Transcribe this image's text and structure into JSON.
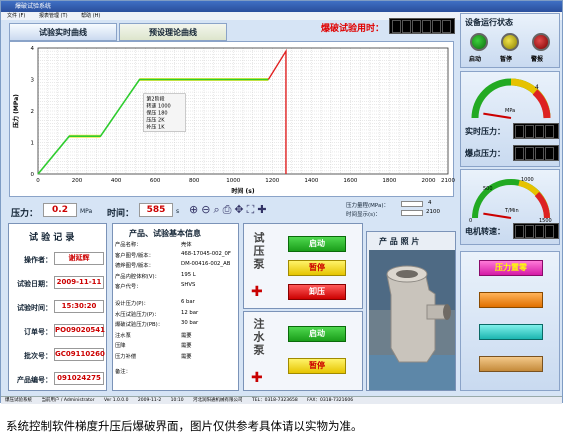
{
  "window": {
    "title": "爆破试验系统",
    "menu": [
      "文件 (F)",
      "报表管理 (T)",
      "帮助 (H)"
    ]
  },
  "tabs": {
    "realtime": "试验实时曲线",
    "preset": "预设理论曲线"
  },
  "timer": {
    "label": "爆破试验用时："
  },
  "chart_data": {
    "type": "line",
    "xlabel": "时间 (s)",
    "ylabel": "压力 (MPa)",
    "xlim": [
      0,
      2100
    ],
    "ylim": [
      0,
      4
    ],
    "x_ticks": [
      0,
      200,
      400,
      600,
      800,
      1000,
      1200,
      1400,
      1600,
      1800,
      2000,
      2100
    ],
    "y_ticks": [
      0,
      1,
      2,
      3,
      4
    ],
    "series": [
      {
        "x": [
          0,
          160,
          320,
          520,
          1180,
          1270,
          1270
        ],
        "y": [
          0,
          1.2,
          1.2,
          3.0,
          3.0,
          3.9,
          0
        ],
        "color": "#2ecc2e"
      }
    ],
    "preset_series": [
      {
        "x": [
          160,
          320
        ],
        "y": [
          1.2,
          1.2
        ]
      },
      {
        "x": [
          520,
          1180
        ],
        "y": [
          3.0,
          3.0
        ]
      }
    ],
    "burst_line": {
      "x": [
        1180,
        1270,
        1270
      ],
      "y": [
        3.0,
        3.9,
        0
      ],
      "color": "#e02020"
    },
    "annotation": [
      "第2阶段",
      "转速 1000",
      "保压 180",
      "压压 2K",
      "补压 1K"
    ]
  },
  "controls": {
    "pressure_label": "压力：",
    "pressure_value": "0.2",
    "pressure_unit": "MPa",
    "time_label": "时间：",
    "time_value": "585",
    "time_unit": "s",
    "range_label": "压力量程(MPa)：",
    "range_value": "4",
    "interval_label": "时间显示(s)：",
    "interval_value": "2100"
  },
  "record": {
    "title": "试 验 记 录",
    "fields": [
      {
        "label": "操作者：",
        "value": "谢延辉"
      },
      {
        "label": "试验日期：",
        "value": "2009-11-11"
      },
      {
        "label": "试验时间：",
        "value": "15:30:20"
      },
      {
        "label": "订单号：",
        "value": "PO09020541"
      },
      {
        "label": "批次号：",
        "value": "GC09110260"
      },
      {
        "label": "产品编号：",
        "value": "091024275"
      }
    ]
  },
  "product": {
    "title": "产品、试验基本信息",
    "rows": [
      {
        "k": "产品名称：",
        "v": "壳体"
      },
      {
        "k": "客户图号/版本：",
        "v": "468-17045-002_0F"
      },
      {
        "k": "德烨图号/版本：",
        "v": "DM-00416-002_AB"
      },
      {
        "k": "产品内腔体积(V)：",
        "v": "195 L"
      },
      {
        "k": "客户代号：",
        "v": "SHVS"
      },
      {
        "k": "设计压力(P)：",
        "v": "6 bar"
      },
      {
        "k": "水压试验压力(P)：",
        "v": "12 bar"
      },
      {
        "k": "爆破试验压力(PB)：",
        "v": "30 bar"
      },
      {
        "k": "注水泵",
        "v": "需要"
      },
      {
        "k": "压降",
        "v": "需要"
      },
      {
        "k": "压力补偿",
        "v": "需要"
      }
    ],
    "note": "备注："
  },
  "pumps": {
    "pressure_pump": "试压泵",
    "water_pump": "注水泵",
    "start": "启动",
    "pause": "暂停",
    "unload": "卸压"
  },
  "photo": {
    "title": "产 品 照 片"
  },
  "status": {
    "title": "设备运行状态",
    "lamps": [
      {
        "label": "启动",
        "color": "#148014"
      },
      {
        "label": "暂停",
        "color": "#b5b000"
      },
      {
        "label": "警报",
        "color": "#b01010"
      }
    ]
  },
  "gauges": {
    "pressure_gauge": {
      "unit": "MPa",
      "max": "4",
      "level": 0.05
    },
    "realtime_label": "实时压力：",
    "burst_label": "爆点压力：",
    "speed_gauge": {
      "unit": "T/Min",
      "min": "0",
      "max": "1500",
      "marks": [
        "500",
        "1000"
      ],
      "level": 0.05
    },
    "motor_label": "电机转速："
  },
  "right_buttons": {
    "zero": "压力置零"
  },
  "statusbar": [
    "爆压试验系统",
    "当前用户 / Administrator",
    "Ver 1.0.0.0",
    "2009-11-2",
    "10:10",
    "河北润阳通机械有限公司",
    "TEL：0318-7323658",
    "FAX：0318-7321606"
  ],
  "caption": "系统控制软件梯度升压后爆破界面，图片仅供参考具体请以实物为准。"
}
